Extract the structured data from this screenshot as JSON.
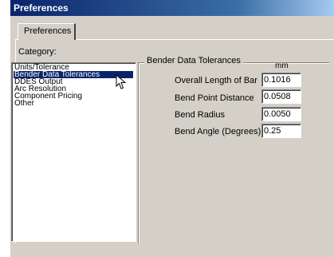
{
  "window": {
    "title": "Preferences"
  },
  "tab": {
    "label": "Preferences"
  },
  "category": {
    "label": "Category:",
    "items": [
      {
        "label": "Units/Tolerance",
        "selected": false
      },
      {
        "label": "Bender Data Tolerances",
        "selected": true
      },
      {
        "label": "DDES Output",
        "selected": false
      },
      {
        "label": "Arc Resolution",
        "selected": false
      },
      {
        "label": "Component Pricing",
        "selected": false
      },
      {
        "label": "Other",
        "selected": false
      }
    ]
  },
  "bender": {
    "title": "Bender Data Tolerances",
    "unit": "mm",
    "rows": [
      {
        "label": "Overall Length of Bar",
        "value": "0.1016"
      },
      {
        "label": "Bend Point Distance",
        "value": "0.0508"
      },
      {
        "label": "Bend Radius",
        "value": "0.0050"
      },
      {
        "label": "Bend Angle (Degrees)",
        "value": "0.25"
      }
    ]
  },
  "colors": {
    "selection": "#0a246a",
    "titlebar": "#0a246a",
    "face": "#d4d0c8"
  },
  "icons": {
    "cursor": "mouse-pointer-icon"
  }
}
